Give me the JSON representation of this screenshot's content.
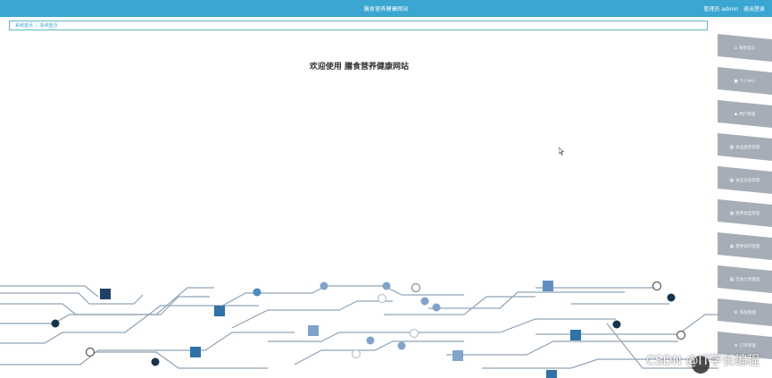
{
  "header": {
    "title": "膳食营养健康网站",
    "user_role": "管理员 admin",
    "logout": "退出登录"
  },
  "breadcrumb": {
    "home": "系统首页",
    "current": "系统首页"
  },
  "main": {
    "welcome": "欢迎使用 膳食营养健康网站"
  },
  "sidebar": {
    "items": [
      {
        "label": "系统首页",
        "icon": "home-icon"
      },
      {
        "label": "个人中心",
        "icon": "user-icon"
      },
      {
        "label": "用户管理",
        "icon": "users-icon"
      },
      {
        "label": "食品类别管理",
        "icon": "grid-icon"
      },
      {
        "label": "食品信息管理",
        "icon": "grid-icon"
      },
      {
        "label": "营养类型管理",
        "icon": "grid-icon"
      },
      {
        "label": "营养知识管理",
        "icon": "grid-icon"
      },
      {
        "label": "饮食计划管理",
        "icon": "grid-icon"
      },
      {
        "label": "系统管理",
        "icon": "gear-icon"
      },
      {
        "label": "订单管理",
        "icon": "list-icon"
      }
    ]
  },
  "watermark": "CSDN @IT学长编程",
  "colors": {
    "topbar": "#3aa6d1",
    "sidebar_item": "#a7adb6",
    "circuit_dark": "#1f4e79",
    "circuit_light": "#8fb0cf"
  }
}
